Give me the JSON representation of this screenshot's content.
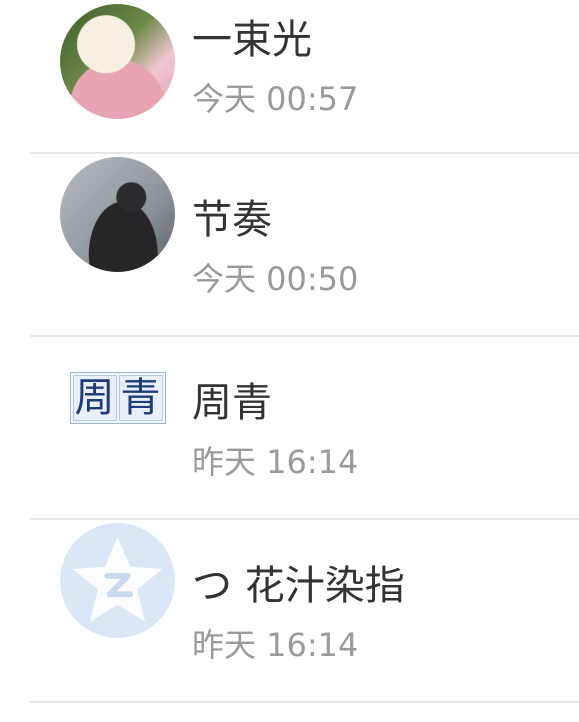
{
  "conversations": [
    {
      "name": "一束光",
      "time": "今天 00:57",
      "avatar": "portrait-avatar"
    },
    {
      "name": "节奏",
      "time": "今天 00:50",
      "avatar": "portrait-avatar"
    },
    {
      "name": "周青",
      "time": "昨天 16:14",
      "avatar": "text-logo-avatar",
      "avatar_text": [
        "周",
        "青"
      ]
    },
    {
      "name": "つ 花汁染指",
      "time": "昨天 16:14",
      "avatar": "default-star-avatar"
    }
  ],
  "colors": {
    "name_text": "#333333",
    "time_text": "#9a9a9a",
    "divider": "#e6e6e6",
    "default_avatar_bg": "#dbe7f6"
  }
}
